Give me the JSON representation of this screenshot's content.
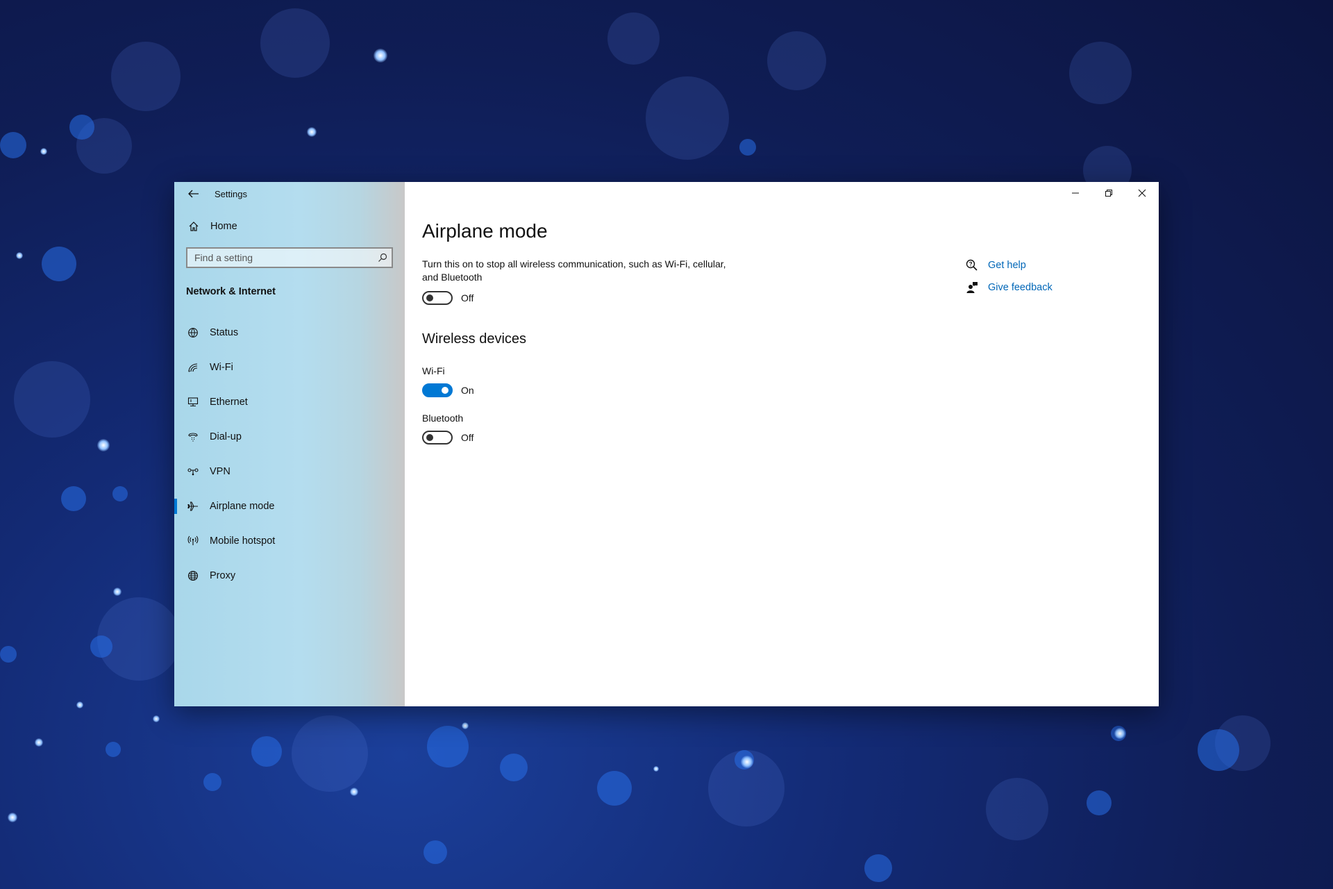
{
  "window": {
    "title": "Settings"
  },
  "sidebar": {
    "home_label": "Home",
    "search_placeholder": "Find a setting",
    "section_title": "Network & Internet",
    "items": [
      {
        "label": "Status",
        "icon": "globe-status-icon"
      },
      {
        "label": "Wi-Fi",
        "icon": "wifi-icon"
      },
      {
        "label": "Ethernet",
        "icon": "ethernet-icon"
      },
      {
        "label": "Dial-up",
        "icon": "dialup-icon"
      },
      {
        "label": "VPN",
        "icon": "vpn-icon"
      },
      {
        "label": "Airplane mode",
        "icon": "airplane-icon",
        "active": true
      },
      {
        "label": "Mobile hotspot",
        "icon": "hotspot-icon"
      },
      {
        "label": "Proxy",
        "icon": "globe-icon"
      }
    ]
  },
  "main": {
    "title": "Airplane mode",
    "description": "Turn this on to stop all wireless communication, such as Wi-Fi, cellular, and Bluetooth",
    "airplane_toggle": {
      "state": "Off",
      "on": false
    },
    "wireless_heading": "Wireless devices",
    "devices": [
      {
        "label": "Wi-Fi",
        "state": "On",
        "on": true
      },
      {
        "label": "Bluetooth",
        "state": "Off",
        "on": false
      }
    ]
  },
  "help": {
    "get_help": "Get help",
    "give_feedback": "Give feedback"
  },
  "colors": {
    "accent": "#0078d4",
    "link": "#0067b8",
    "sidebar_bg": "#b4ddef"
  }
}
